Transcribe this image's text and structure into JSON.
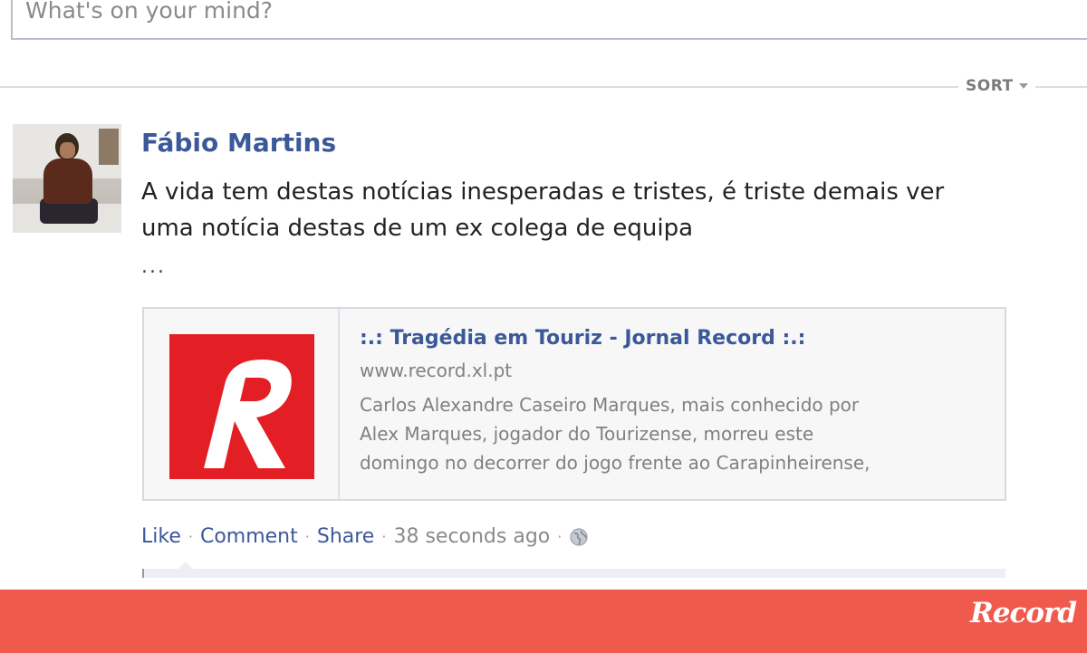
{
  "composer": {
    "placeholder": "What's on your mind?"
  },
  "feed": {
    "sort_label": "SORT"
  },
  "post": {
    "author": "Fábio Martins",
    "text_lines": [
      "A vida tem destas notícias inesperadas e tristes, é triste demais ver",
      "uma notícia destas de um ex colega de equipa"
    ],
    "more": "...",
    "link": {
      "title": ":.: Tragédia em Touriz - Jornal Record :.:",
      "domain": "www.record.xl.pt",
      "description_lines": [
        "Carlos Alexandre Caseiro Marques, mais conhecido por",
        "Alex Marques, jogador do Tourizense, morreu este",
        "domingo no decorrer do jogo frente ao Carapinheirense,"
      ],
      "thumbnail_letter": "R"
    },
    "actions": {
      "like": "Like",
      "comment": "Comment",
      "share": "Share",
      "timestamp": "38 seconds ago",
      "separator": "·"
    }
  },
  "footer": {
    "brand": "Record",
    "color": "#ef5a4c"
  },
  "colors": {
    "link_blue": "#3b5998",
    "record_red": "#e31e24"
  },
  "icons": {
    "avatar": "user-photo",
    "privacy": "globe-icon",
    "sort": "chevron-down-icon"
  }
}
